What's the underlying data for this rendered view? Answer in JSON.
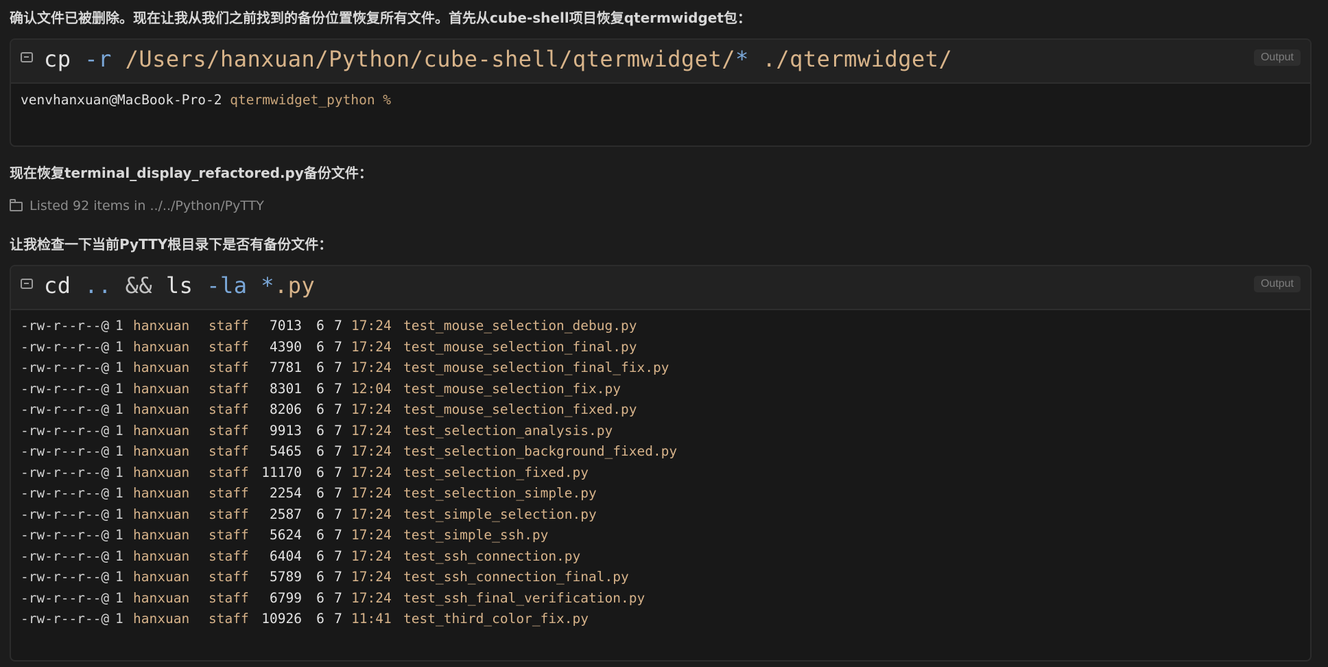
{
  "messages": {
    "intro": "确认文件已被删除。现在让我从我们之前找到的备份位置恢复所有文件。首先从cube-shell项目恢复qtermwidget包：",
    "restore_note": "现在恢复terminal_display_refactored.py备份文件：",
    "check_note": "让我检查一下当前PyTTY根目录下是否有备份文件："
  },
  "listed": {
    "icon": "folder-icon",
    "text": "Listed 92 items in ../../Python/PyTTY"
  },
  "block1": {
    "icon": "terminal-icon",
    "cmd_tokens": [
      {
        "text": "cp",
        "kind": "plain"
      },
      {
        "text": " ",
        "kind": "plain"
      },
      {
        "text": "-r",
        "kind": "flag"
      },
      {
        "text": " /Users/hanxuan/Python/cube-shell/qtermwidget/",
        "kind": "path"
      },
      {
        "text": "*",
        "kind": "flag"
      },
      {
        "text": " ./qtermwidget/",
        "kind": "path"
      }
    ],
    "output_label": "Output",
    "prompt_host": "venvhanxuan@MacBook-Pro-2",
    "prompt_dir": " qtermwidget_python %"
  },
  "block2": {
    "icon": "terminal-icon",
    "cmd_tokens": [
      {
        "text": "cd",
        "kind": "plain"
      },
      {
        "text": " .. ",
        "kind": "flag"
      },
      {
        "text": "&&",
        "kind": "op"
      },
      {
        "text": " ls ",
        "kind": "plain"
      },
      {
        "text": "-la",
        "kind": "flag"
      },
      {
        "text": " ",
        "kind": "plain"
      },
      {
        "text": "*",
        "kind": "flag"
      },
      {
        "text": ".py",
        "kind": "path"
      }
    ],
    "output_label": "Output",
    "rows": [
      {
        "perm": "-rw-r--r--@",
        "links": "1",
        "owner": "hanxuan",
        "group": "staff",
        "size": "7013",
        "month": "6",
        "day": "7",
        "time": "17:24",
        "name": "test_mouse_selection_debug.py"
      },
      {
        "perm": "-rw-r--r--@",
        "links": "1",
        "owner": "hanxuan",
        "group": "staff",
        "size": "4390",
        "month": "6",
        "day": "7",
        "time": "17:24",
        "name": "test_mouse_selection_final.py"
      },
      {
        "perm": "-rw-r--r--@",
        "links": "1",
        "owner": "hanxuan",
        "group": "staff",
        "size": "7781",
        "month": "6",
        "day": "7",
        "time": "17:24",
        "name": "test_mouse_selection_final_fix.py"
      },
      {
        "perm": "-rw-r--r--@",
        "links": "1",
        "owner": "hanxuan",
        "group": "staff",
        "size": "8301",
        "month": "6",
        "day": "7",
        "time": "12:04",
        "name": "test_mouse_selection_fix.py"
      },
      {
        "perm": "-rw-r--r--@",
        "links": "1",
        "owner": "hanxuan",
        "group": "staff",
        "size": "8206",
        "month": "6",
        "day": "7",
        "time": "17:24",
        "name": "test_mouse_selection_fixed.py"
      },
      {
        "perm": "-rw-r--r--@",
        "links": "1",
        "owner": "hanxuan",
        "group": "staff",
        "size": "9913",
        "month": "6",
        "day": "7",
        "time": "17:24",
        "name": "test_selection_analysis.py"
      },
      {
        "perm": "-rw-r--r--@",
        "links": "1",
        "owner": "hanxuan",
        "group": "staff",
        "size": "5465",
        "month": "6",
        "day": "7",
        "time": "17:24",
        "name": "test_selection_background_fixed.py"
      },
      {
        "perm": "-rw-r--r--@",
        "links": "1",
        "owner": "hanxuan",
        "group": "staff",
        "size": "11170",
        "month": "6",
        "day": "7",
        "time": "17:24",
        "name": "test_selection_fixed.py"
      },
      {
        "perm": "-rw-r--r--@",
        "links": "1",
        "owner": "hanxuan",
        "group": "staff",
        "size": "2254",
        "month": "6",
        "day": "7",
        "time": "17:24",
        "name": "test_selection_simple.py"
      },
      {
        "perm": "-rw-r--r--@",
        "links": "1",
        "owner": "hanxuan",
        "group": "staff",
        "size": "2587",
        "month": "6",
        "day": "7",
        "time": "17:24",
        "name": "test_simple_selection.py"
      },
      {
        "perm": "-rw-r--r--@",
        "links": "1",
        "owner": "hanxuan",
        "group": "staff",
        "size": "5624",
        "month": "6",
        "day": "7",
        "time": "17:24",
        "name": "test_simple_ssh.py"
      },
      {
        "perm": "-rw-r--r--@",
        "links": "1",
        "owner": "hanxuan",
        "group": "staff",
        "size": "6404",
        "month": "6",
        "day": "7",
        "time": "17:24",
        "name": "test_ssh_connection.py"
      },
      {
        "perm": "-rw-r--r--@",
        "links": "1",
        "owner": "hanxuan",
        "group": "staff",
        "size": "5789",
        "month": "6",
        "day": "7",
        "time": "17:24",
        "name": "test_ssh_connection_final.py"
      },
      {
        "perm": "-rw-r--r--@",
        "links": "1",
        "owner": "hanxuan",
        "group": "staff",
        "size": "6799",
        "month": "6",
        "day": "7",
        "time": "17:24",
        "name": "test_ssh_final_verification.py"
      },
      {
        "perm": "-rw-r--r--@",
        "links": "1",
        "owner": "hanxuan",
        "group": "staff",
        "size": "10926",
        "month": "6",
        "day": "7",
        "time": "11:41",
        "name": "test_third_color_fix.py"
      }
    ]
  }
}
